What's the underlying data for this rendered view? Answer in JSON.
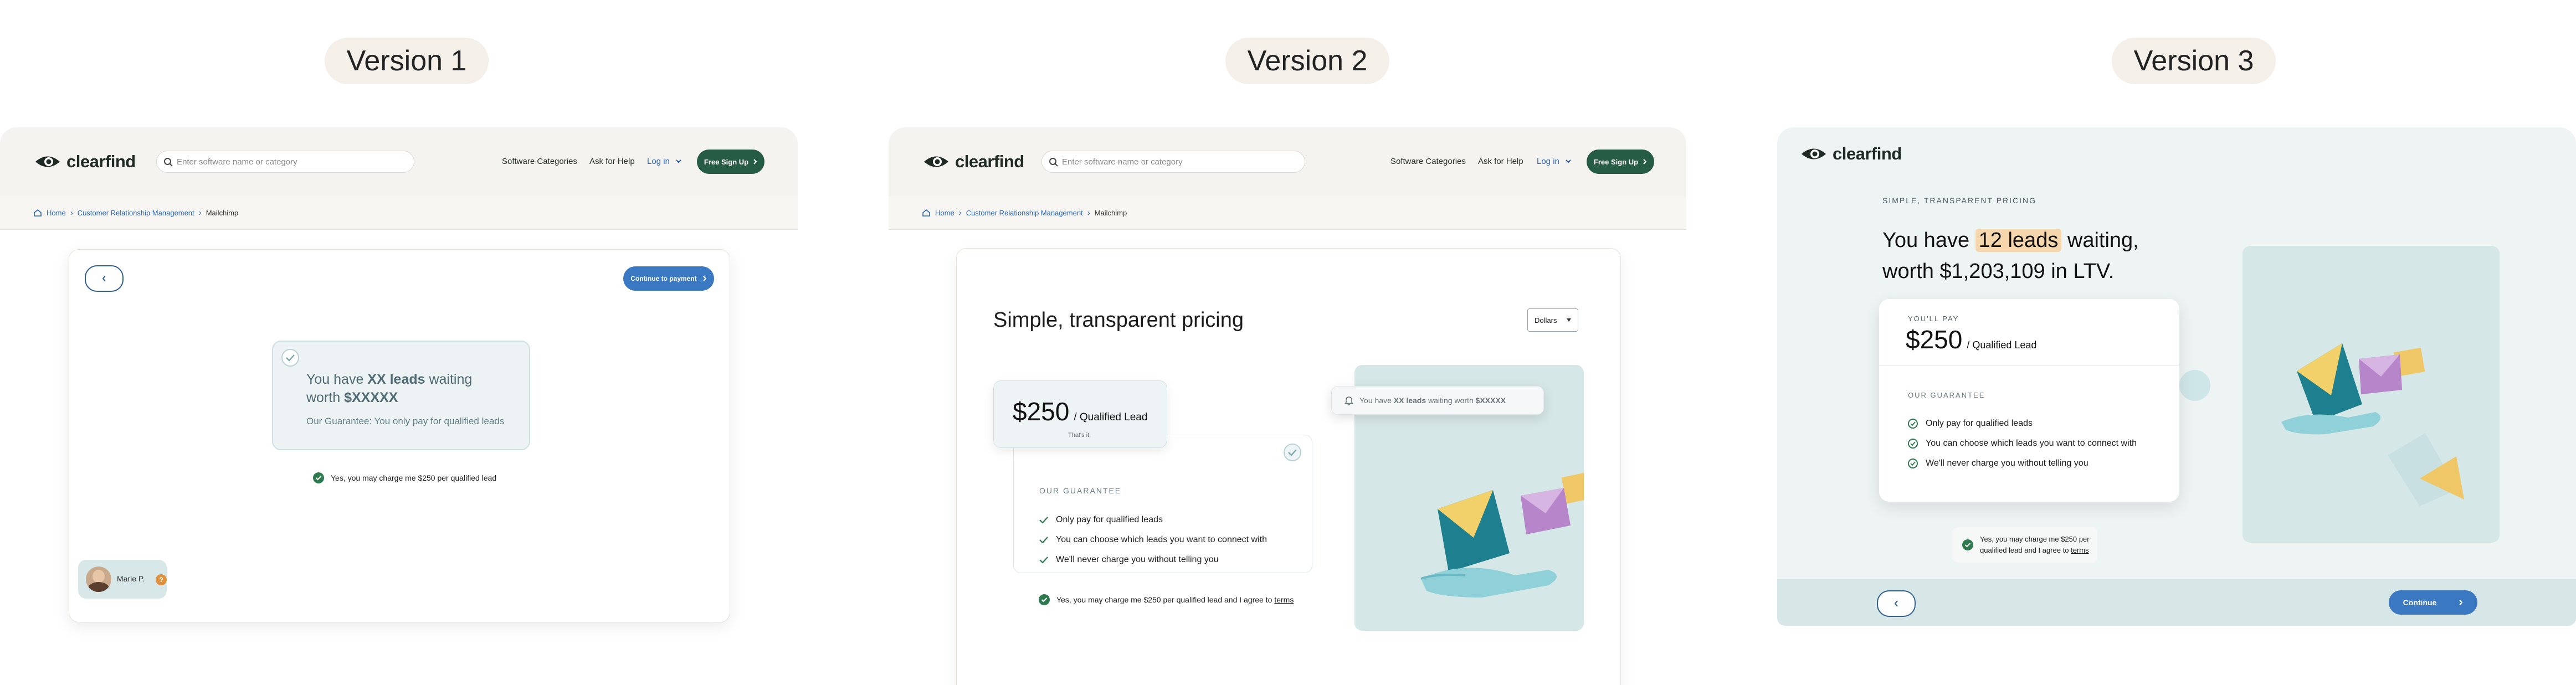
{
  "versions": [
    "Version 1",
    "Version 2",
    "Version 3"
  ],
  "brand": {
    "name": "clearfind",
    "green": "#265c44",
    "blue": "#3a78c2",
    "link_blue": "#2763b6",
    "highlight": "#f6d7ad"
  },
  "header": {
    "search_placeholder": "Enter software name or category",
    "nav_categories": "Software Categories",
    "nav_help": "Ask for Help",
    "nav_login": "Log in",
    "signup": "Free Sign Up"
  },
  "breadcrumb": [
    "Home",
    "Customer Relationship Management",
    "Mailchimp"
  ],
  "v1": {
    "continue_payment": "Continue to payment",
    "leads_line1_pre": "You have ",
    "leads_count": "XX leads",
    "leads_line1_post": " waiting",
    "leads_line2_pre": "worth ",
    "leads_value": "$XXXXX",
    "guarantee": "Our Guarantee: You only pay for qualified leads",
    "consent": "Yes, you may charge me $250 per qualified lead",
    "user_name": "Marie P.",
    "user_badge": "?"
  },
  "v2": {
    "title": "Simple, transparent pricing",
    "currency_select": "Dollars",
    "price": "$250",
    "price_unit": "/ Qualified Lead",
    "price_note": "That's it.",
    "guarantee_label": "OUR GUARANTEE",
    "guarantee_items": [
      "Only pay for qualified leads",
      "You can choose which leads you want to connect with",
      "We'll never charge you without telling you"
    ],
    "notification_pre": "You have ",
    "notification_leads": "XX leads",
    "notification_mid": " waiting worth ",
    "notification_value": "$XXXXX",
    "consent_pre": "Yes, you may charge me $250 per qualified lead and I agree to ",
    "consent_link": "terms"
  },
  "v3": {
    "eyebrow": "SIMPLE, TRANSPARENT PRICING",
    "headline_pre": "You have ",
    "headline_leads": "12 leads",
    "headline_post": " waiting,",
    "headline_line2": "worth $1,203,109 in LTV.",
    "pay_label": "YOU'LL PAY",
    "price": "$250",
    "price_unit": "/ Qualified Lead",
    "guarantee_label": "OUR GUARANTEE",
    "guarantee_items": [
      "Only pay for qualified leads",
      "You can choose which leads you want to connect with",
      "We'll never charge you without telling you"
    ],
    "consent_line1": "Yes, you may charge me $250 per",
    "consent_line2_pre": "qualified lead and I agree to ",
    "consent_link": "terms",
    "continue": "Continue"
  }
}
